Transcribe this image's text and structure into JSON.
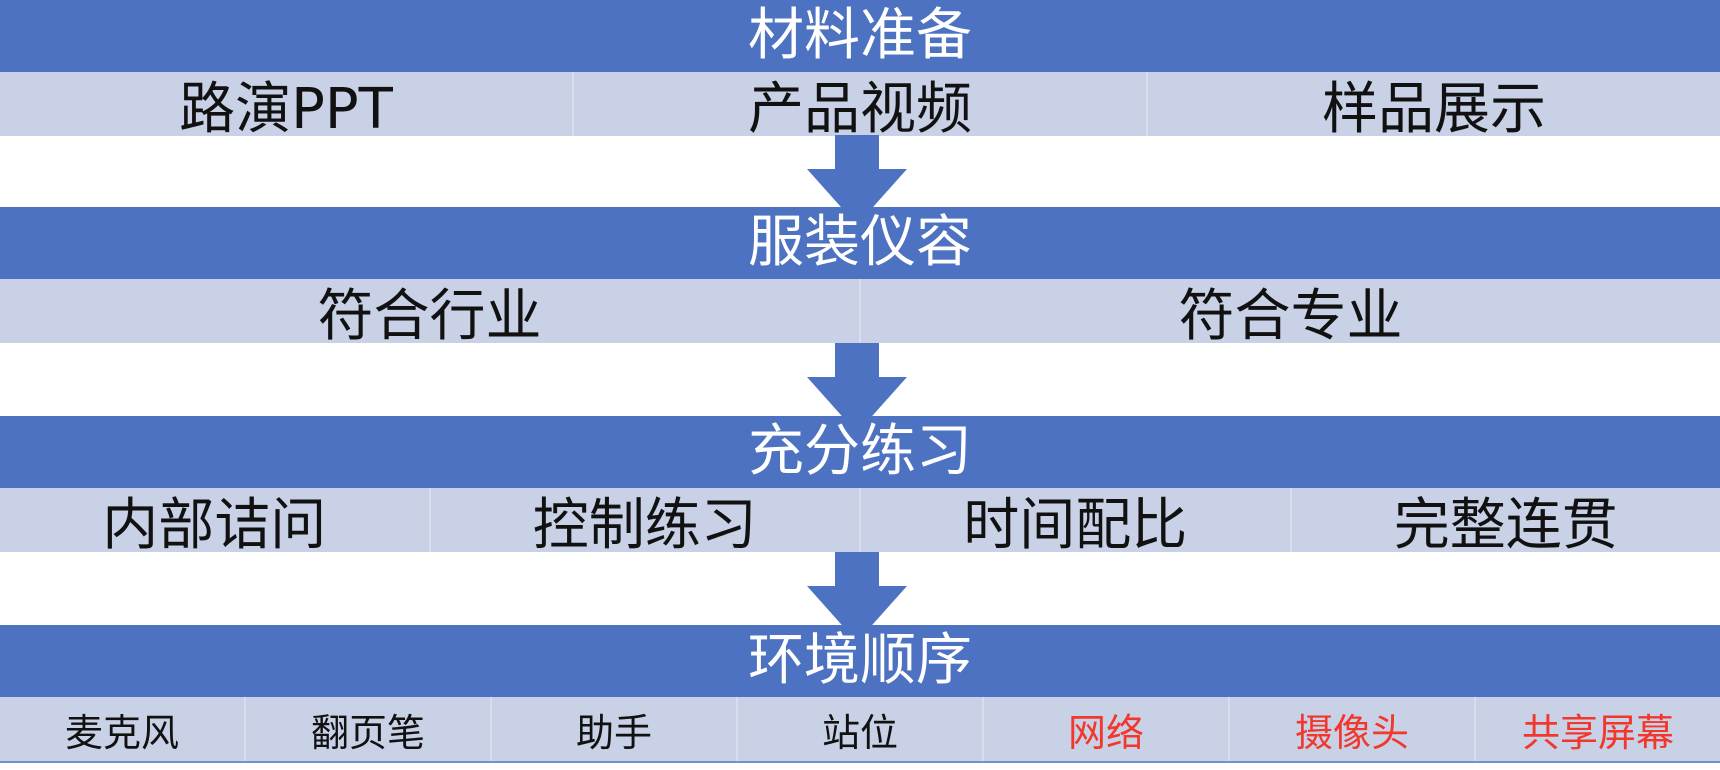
{
  "stages": [
    {
      "title": "材料准备",
      "items": [
        {
          "label": "路演PPT"
        },
        {
          "label": "产品视频"
        },
        {
          "label": "样品展示"
        }
      ]
    },
    {
      "title": "服装仪容",
      "items": [
        {
          "label": "符合行业"
        },
        {
          "label": "符合专业"
        }
      ]
    },
    {
      "title": "充分练习",
      "items": [
        {
          "label": "内部诘问"
        },
        {
          "label": "控制练习"
        },
        {
          "label": "时间配比"
        },
        {
          "label": "完整连贯"
        }
      ]
    },
    {
      "title": "环境顺序",
      "items": [
        {
          "label": "麦克风"
        },
        {
          "label": "翻页笔"
        },
        {
          "label": "助手"
        },
        {
          "label": "站位"
        },
        {
          "label": "网络"
        },
        {
          "label": "摄像头"
        },
        {
          "label": "共享屏幕"
        }
      ]
    }
  ],
  "colors": {
    "header_bg": "#4d72c2",
    "row_bg": "#c8d1e6",
    "arrow": "#4d72c2",
    "highlight_text": "#f2372d",
    "text": "#111111"
  }
}
